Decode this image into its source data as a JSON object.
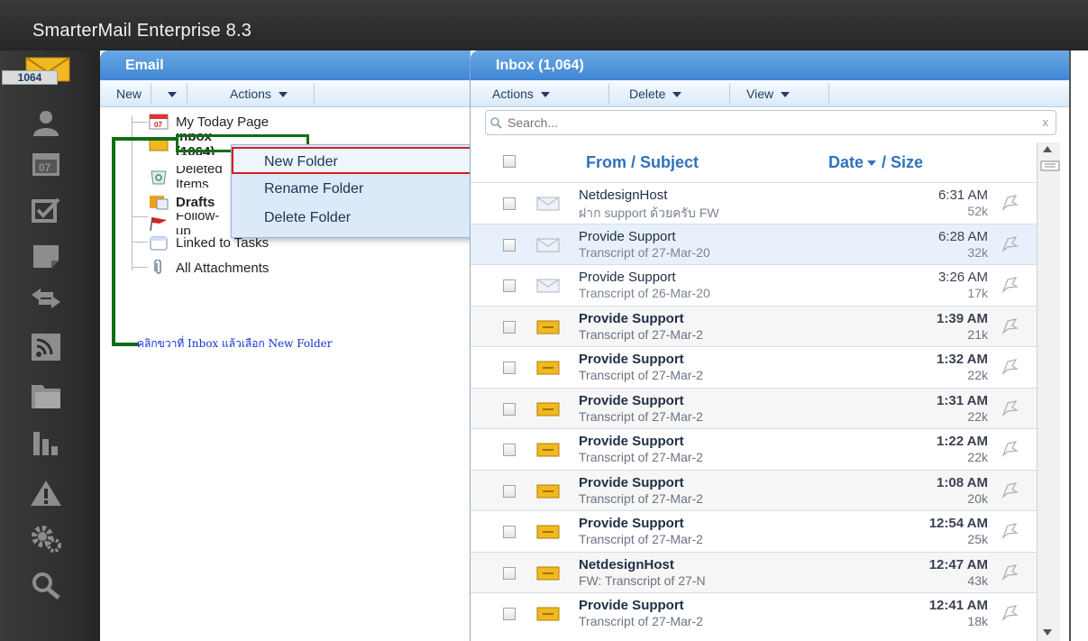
{
  "app": {
    "title": "SmarterMail Enterprise 8.3"
  },
  "rail": {
    "mail_badge": "1064"
  },
  "email_panel": {
    "title": "Email",
    "toolbar": {
      "new_label": "New",
      "actions_label": "Actions"
    },
    "folders": [
      {
        "label": "My Today Page",
        "icon": "calendar-icon"
      },
      {
        "label": "Inbox (1064)",
        "icon": "inbox-icon"
      },
      {
        "label": "Deleted Items",
        "icon": "trash-icon"
      },
      {
        "label": "Drafts",
        "icon": "drafts-icon"
      },
      {
        "label": "Follow-up",
        "icon": "flag-icon"
      },
      {
        "label": "Linked to Tasks",
        "icon": "folder-icon"
      },
      {
        "label": "All Attachments",
        "icon": "paperclip-icon"
      }
    ]
  },
  "context_menu": {
    "items": [
      {
        "label": "New Folder"
      },
      {
        "label": "Rename Folder"
      },
      {
        "label": "Delete Folder"
      }
    ]
  },
  "annotation": {
    "text": "คลิกขวาที่ Inbox แล้วเลือก New Folder"
  },
  "inbox_panel": {
    "title": "Inbox (1,064)",
    "toolbar": {
      "actions_label": "Actions",
      "delete_label": "Delete",
      "view_label": "View"
    },
    "search": {
      "placeholder": "Search..."
    },
    "columns": {
      "subject": "From / Subject",
      "date": "Date",
      "size": "/ Size"
    },
    "messages": [
      {
        "from": "NetdesignHost",
        "subject": "ฝาก support ด้วยครับ FW",
        "time": "6:31 AM",
        "size": "52k",
        "read": true
      },
      {
        "from": "Provide Support",
        "subject": "Transcript of 27-Mar-20",
        "time": "6:28 AM",
        "size": "32k",
        "read": true
      },
      {
        "from": "Provide Support",
        "subject": "Transcript of 26-Mar-20",
        "time": "3:26 AM",
        "size": "17k",
        "read": true
      },
      {
        "from": "Provide Support",
        "subject": "Transcript of 27-Mar-2",
        "time": "1:39 AM",
        "size": "21k",
        "read": false
      },
      {
        "from": "Provide Support",
        "subject": "Transcript of 27-Mar-2",
        "time": "1:32 AM",
        "size": "22k",
        "read": false
      },
      {
        "from": "Provide Support",
        "subject": "Transcript of 27-Mar-2",
        "time": "1:31 AM",
        "size": "22k",
        "read": false
      },
      {
        "from": "Provide Support",
        "subject": "Transcript of 27-Mar-2",
        "time": "1:22 AM",
        "size": "22k",
        "read": false
      },
      {
        "from": "Provide Support",
        "subject": "Transcript of 27-Mar-2",
        "time": "1:08 AM",
        "size": "20k",
        "read": false
      },
      {
        "from": "Provide Support",
        "subject": "Transcript of 27-Mar-2",
        "time": "12:54 AM",
        "size": "25k",
        "read": false
      },
      {
        "from": "NetdesignHost",
        "subject": "FW: Transcript of 27-N",
        "time": "12:47 AM",
        "size": "43k",
        "read": false
      },
      {
        "from": "Provide Support",
        "subject": "Transcript of 27-Mar-2",
        "time": "12:41 AM",
        "size": "18k",
        "read": false
      }
    ]
  },
  "colors": {
    "header_blue": "#4a90d9",
    "annotation_green": "#0f6e13",
    "highlight_red": "#d42020"
  }
}
